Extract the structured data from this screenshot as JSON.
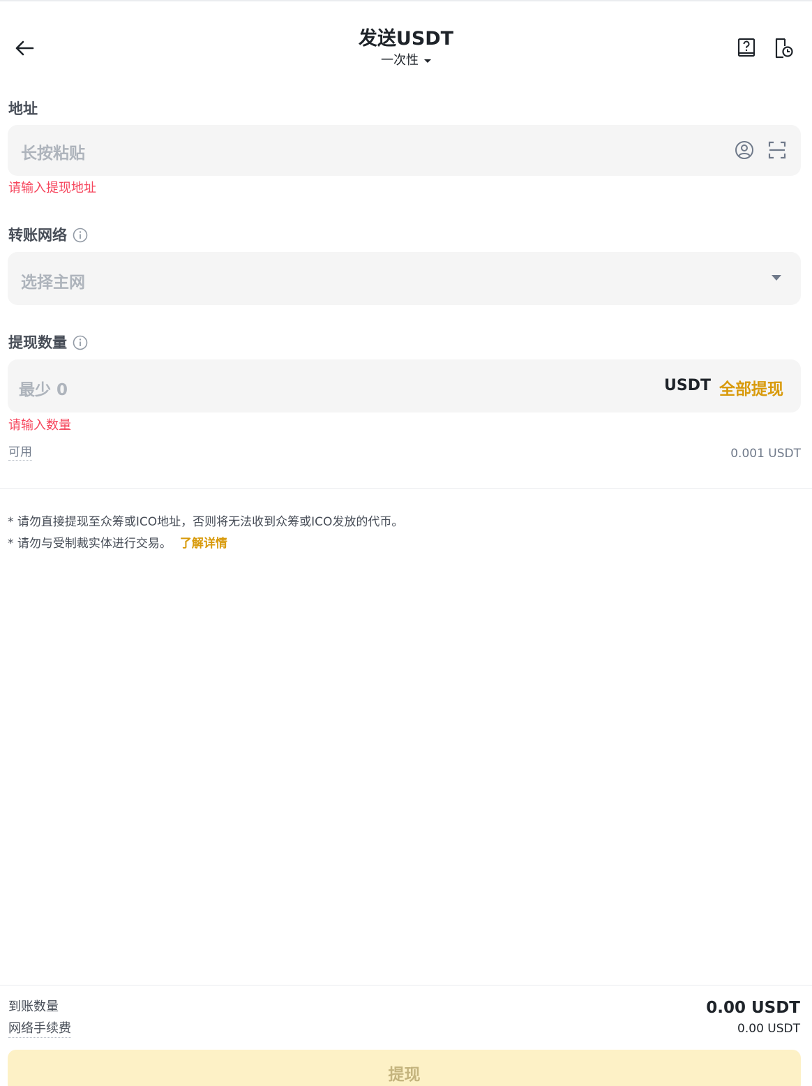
{
  "header": {
    "title": "发送USDT",
    "subtitle": "一次性",
    "icons": [
      "arrow-left-icon",
      "help-book-icon",
      "history-icon"
    ]
  },
  "address": {
    "label": "地址",
    "placeholder": "长按粘贴",
    "error": "请输入提现地址",
    "icons": [
      "contact-icon",
      "scan-icon"
    ]
  },
  "network": {
    "label": "转账网络",
    "placeholder": "选择主网"
  },
  "amount": {
    "label": "提现数量",
    "placeholder": "最少 0",
    "unit": "USDT",
    "max_label": "全部提现",
    "error": "请输入数量",
    "available_label": "可用",
    "available_value": "0.001 USDT"
  },
  "notes": {
    "line1": "* 请勿直接提现至众筹或ICO地址，否则将无法收到众筹或ICO发放的代币。",
    "line2": "* 请勿与受制裁实体进行交易。",
    "link": "了解详情"
  },
  "summary": {
    "receive_label": "到账数量",
    "receive_value": "0.00 USDT",
    "fee_label": "网络手续费",
    "fee_value": "0.00 USDT"
  },
  "submit_label": "提现",
  "colors": {
    "accent": "#d89a0b",
    "error": "#f6465d",
    "input_bg": "#f5f5f5",
    "button_disabled_bg": "#fdf1c6"
  }
}
